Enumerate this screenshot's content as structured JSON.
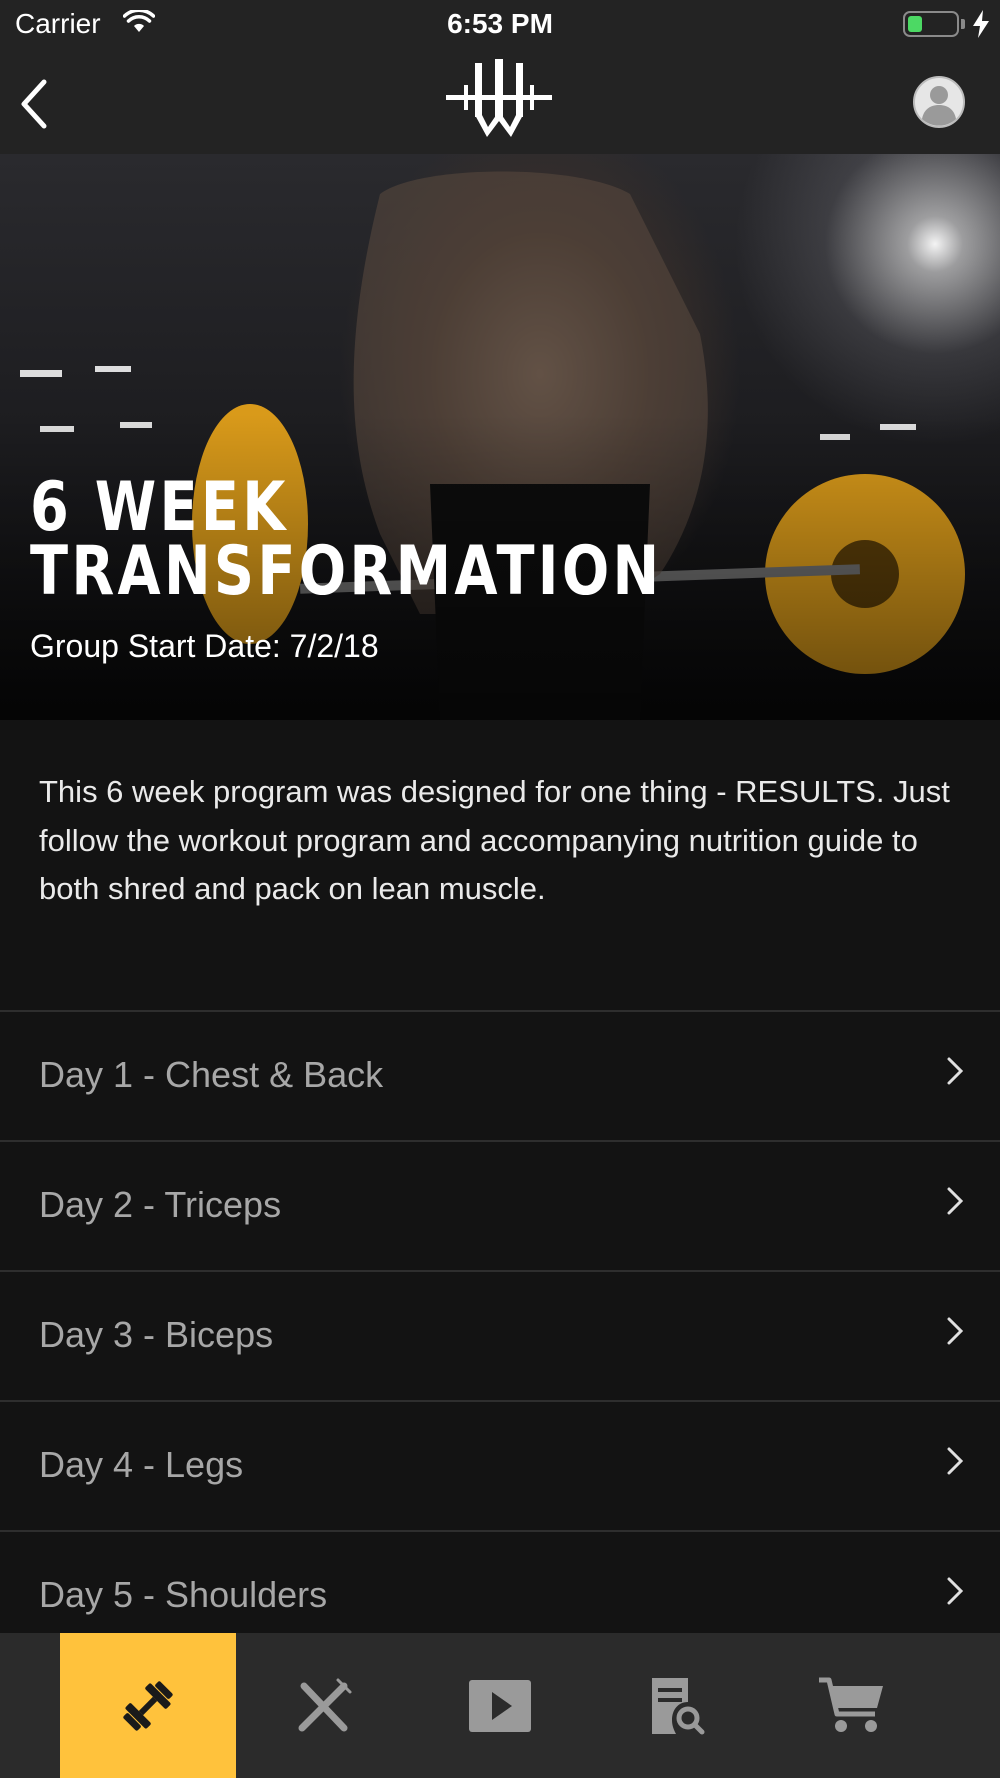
{
  "status_bar": {
    "carrier": "Carrier",
    "time": "6:53 PM",
    "battery_level": 0.3
  },
  "nav": {
    "back_icon": "chevron-left-icon",
    "logo_icon": "barbell-w-logo",
    "profile_icon": "user-avatar-icon"
  },
  "hero": {
    "title": "6 WEEK\nTRANSFORMATION",
    "subtitle": "Group Start Date: 7/2/18"
  },
  "description": "This 6 week program was designed for one thing - RESULTS. Just follow the workout program and accompanying nutrition guide to both shred and pack on lean muscle.",
  "days": [
    {
      "label": "Day 1 - Chest & Back"
    },
    {
      "label": "Day 2 - Triceps"
    },
    {
      "label": "Day 3 - Biceps"
    },
    {
      "label": "Day 4 - Legs"
    },
    {
      "label": "Day 5 - Shoulders"
    }
  ],
  "tabs": [
    {
      "icon": "dumbbell-icon",
      "active": true
    },
    {
      "icon": "fork-knife-icon",
      "active": false
    },
    {
      "icon": "play-video-icon",
      "active": false
    },
    {
      "icon": "document-search-icon",
      "active": false
    },
    {
      "icon": "shopping-cart-icon",
      "active": false
    }
  ],
  "colors": {
    "accent": "#ffc23c",
    "bar": "#232323",
    "background": "#131313",
    "battery": "#4cd964"
  }
}
